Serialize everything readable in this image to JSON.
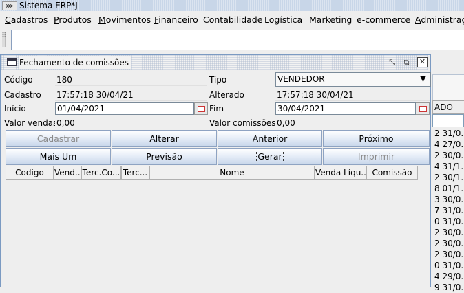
{
  "window": {
    "title": "Sistema ERP*J",
    "icon": "app-logo-icon"
  },
  "menu": [
    {
      "label": "Cadastros",
      "mnemonic": "C",
      "rest": "adastros"
    },
    {
      "label": "Produtos",
      "mnemonic": "P",
      "rest": "rodutos"
    },
    {
      "label": "Movimentos",
      "mnemonic": "M",
      "rest": "ovimentos"
    },
    {
      "label": "Financeiro",
      "mnemonic": "F",
      "rest": "inanceiro"
    },
    {
      "label": "Contabilidade",
      "mnemonic": "",
      "rest": "Contabilidade"
    },
    {
      "label": "Logística",
      "mnemonic": "",
      "rest": "Logística"
    },
    {
      "label": "Marketing",
      "mnemonic": "",
      "rest": "Marketing"
    },
    {
      "label": "e-commerce",
      "mnemonic": "",
      "rest": "e-commerce"
    },
    {
      "label": "Administração",
      "mnemonic": "A",
      "rest": "dministraçã"
    }
  ],
  "background_table": {
    "header": "ADO",
    "cells": [
      "2 31/0...",
      "4 27/0...",
      "2 30/0...",
      "4 31/1...",
      "2 30/1...",
      "8 01/1...",
      "3 30/0...",
      "7 31/0...",
      "0 31/0...",
      "2 30/0...",
      "2 30/0...",
      "2 30/0...",
      "0 31/0...",
      "4 29/0...",
      "9 31/0..."
    ]
  },
  "frame": {
    "title": "Fechamento de comissões",
    "controls": [
      "minimize-icon",
      "maximize-icon",
      "close-icon"
    ]
  },
  "form": {
    "codigo_label": "Código",
    "codigo_value": "180",
    "tipo_label": "Tipo",
    "tipo_value": "VENDEDOR",
    "cadastro_label": "Cadastro",
    "cadastro_value": "17:57:18 30/04/21",
    "alterado_label": "Alterado",
    "alterado_value": "17:57:18 30/04/21",
    "inicio_label": "Início",
    "inicio_value": "01/04/2021",
    "fim_label": "Fim",
    "fim_value": "30/04/2021",
    "valor_vendas_label": "Valor vendas",
    "valor_vendas_value": "0,00",
    "valor_comissoes_label": "Valor comissões",
    "valor_comissoes_value": "0,00"
  },
  "buttons": {
    "cadastrar": "Cadastrar",
    "alterar": "Alterar",
    "anterior": "Anterior",
    "proximo": "Próximo",
    "mais_um": "Mais Um",
    "previsao": "Previsão",
    "gerar": "Gerar",
    "imprimir": "Imprimir"
  },
  "grid": {
    "columns": [
      "Codigo",
      "Vend...",
      "Terc.Co...",
      "Terc...",
      "Nome",
      "Venda Líqu...",
      "Comissão"
    ]
  }
}
